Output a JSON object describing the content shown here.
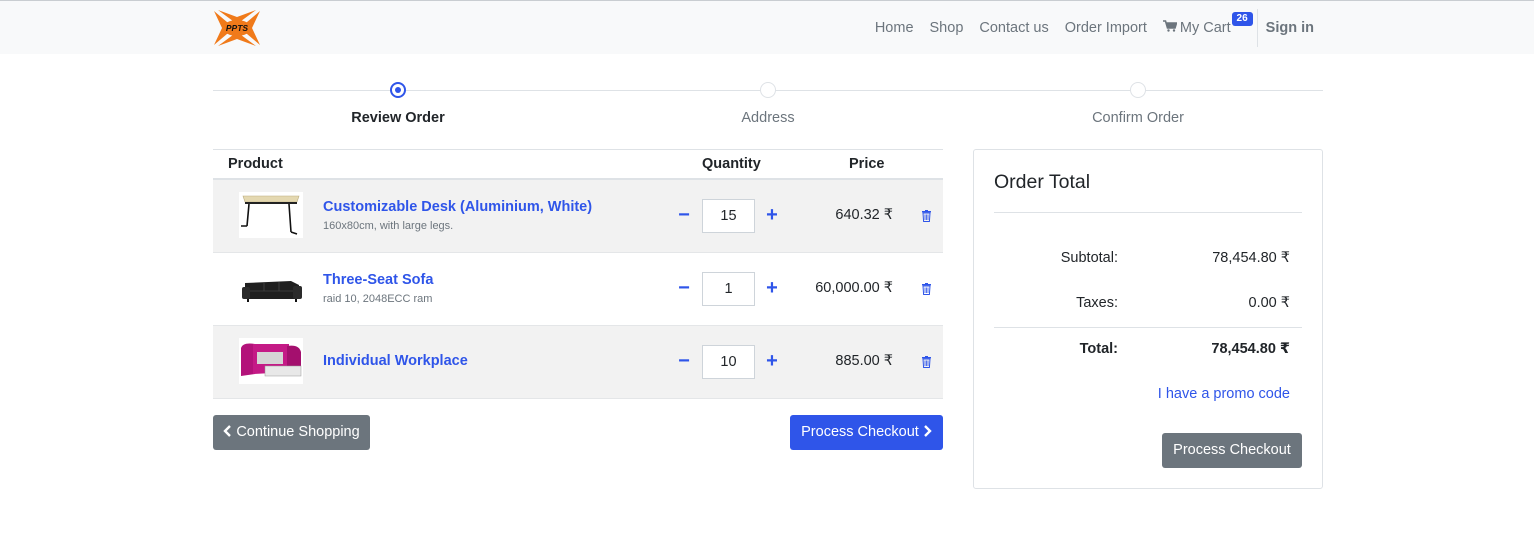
{
  "navbar": {
    "logo_text": "PPTS",
    "links": [
      "Home",
      "Shop",
      "Contact us",
      "Order Import"
    ],
    "cart_label": "My Cart",
    "cart_count": "26",
    "signin": "Sign in"
  },
  "steps": [
    "Review Order",
    "Address",
    "Confirm Order"
  ],
  "table": {
    "headers": {
      "product": "Product",
      "quantity": "Quantity",
      "price": "Price"
    },
    "items": [
      {
        "name": "Customizable Desk (Aluminium, White)",
        "desc": "160x80cm, with large legs.",
        "qty": "15",
        "price": "640.32 ₹"
      },
      {
        "name": "Three-Seat Sofa",
        "desc": "raid 10, 2048ECC ram",
        "qty": "1",
        "price": "60,000.00 ₹"
      },
      {
        "name": "Individual Workplace",
        "desc": "",
        "qty": "10",
        "price": "885.00 ₹"
      }
    ]
  },
  "buttons": {
    "continue": "Continue Shopping",
    "checkout": "Process Checkout"
  },
  "summary": {
    "title": "Order Total",
    "subtotal_label": "Subtotal:",
    "subtotal": "78,454.80 ₹",
    "taxes_label": "Taxes:",
    "taxes": "0.00 ₹",
    "total_label": "Total:",
    "total": "78,454.80 ₹",
    "promo": "I have a promo code",
    "checkout": "Process Checkout"
  },
  "colors": {
    "primary": "#2f55e9",
    "secondary": "#6c757d",
    "logo": "#f07a1a"
  }
}
